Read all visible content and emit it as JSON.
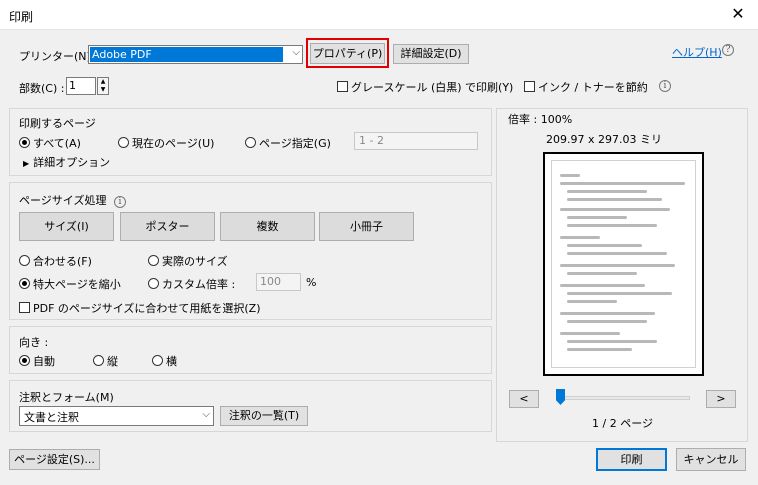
{
  "window": {
    "title": "印刷",
    "close_glyph": "✕"
  },
  "printer": {
    "label": "プリンター(N) :",
    "value": "Adobe PDF",
    "properties_label": "プロパティ(P)",
    "advanced_label": "詳細設定(D)"
  },
  "help": {
    "label": "ヘルプ(H)",
    "icon_glyph": "?"
  },
  "copies": {
    "label": "部数(C) :",
    "value": "1"
  },
  "options": {
    "grayscale_label": "グレースケール (白黒) で印刷(Y)",
    "save_ink_label": "インク / トナーを節約"
  },
  "pages": {
    "heading": "印刷するページ",
    "all_label": "すべて(A)",
    "current_label": "現在のページ(U)",
    "range_label": "ページ指定(G)",
    "range_value": "1 - 2",
    "more_options_label": "詳細オプション"
  },
  "sizing": {
    "heading": "ページサイズ処理",
    "tabs": [
      "サイズ(I)",
      "ポスター",
      "複数",
      "小冊子"
    ],
    "fit_label": "合わせる(F)",
    "actual_label": "実際のサイズ",
    "shrink_label": "特大ページを縮小",
    "custom_label": "カスタム倍率 :",
    "custom_value": "100",
    "percent_sign": "%",
    "choose_paper_label": "PDF のページサイズに合わせて用紙を選択(Z)"
  },
  "orientation": {
    "heading": "向き :",
    "auto_label": "自動",
    "portrait_label": "縦",
    "landscape_label": "横"
  },
  "comments": {
    "heading": "注釈とフォーム(M)",
    "value": "文書と注釈",
    "summarize_label": "注釈の一覧(T)"
  },
  "preview": {
    "scale_label": "倍率 : 100%",
    "dimensions_label": "209.97 x 297.03 ミリ",
    "page_counter": "1 / 2 ページ",
    "prev_glyph": "<",
    "next_glyph": ">",
    "slider_position": 0
  },
  "footer": {
    "page_setup_label": "ページ設定(S)...",
    "print_label": "印刷",
    "cancel_label": "キャンセル"
  }
}
